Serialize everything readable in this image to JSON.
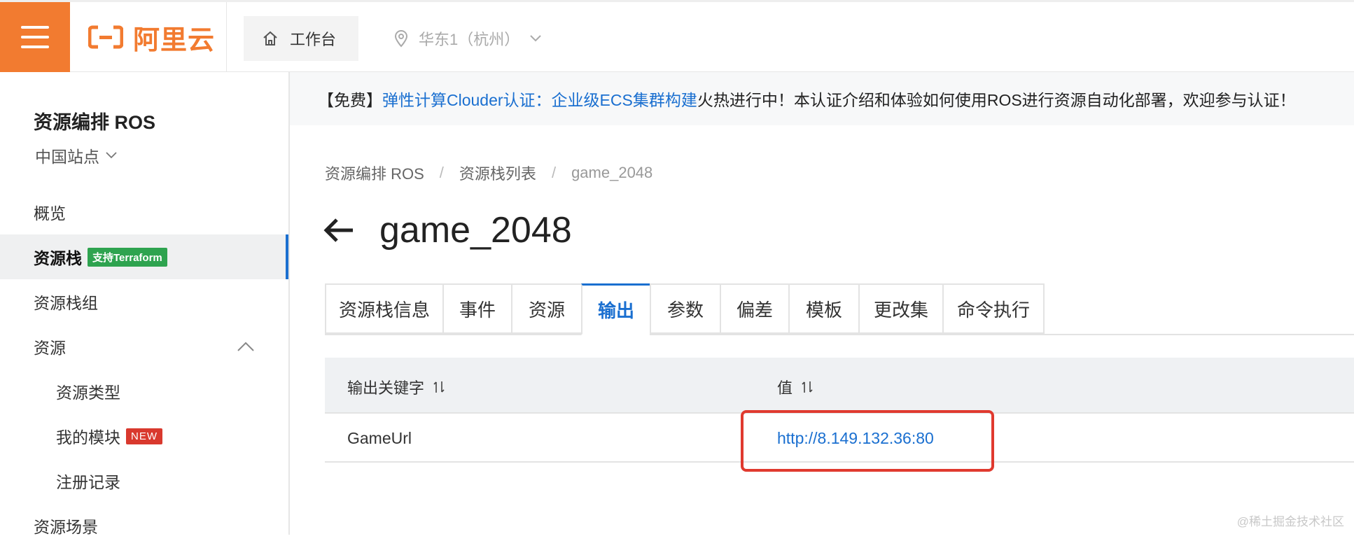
{
  "header": {
    "logo_text": "阿里云",
    "workbench_label": "工作台",
    "region_label": "华东1（杭州）"
  },
  "sidebar": {
    "title": "资源编排 ROS",
    "site": "中国站点",
    "items": [
      {
        "label": "概览"
      },
      {
        "label": "资源栈",
        "badge": "支持Terraform"
      },
      {
        "label": "资源栈组"
      },
      {
        "label": "资源"
      },
      {
        "label": "资源类型"
      },
      {
        "label": "我的模块",
        "badge": "NEW"
      },
      {
        "label": "注册记录"
      },
      {
        "label": "资源场景"
      }
    ]
  },
  "notice": {
    "prefix": "【免费】",
    "link1": "弹性计算Clouder认证：",
    "link2": "企业级ECS集群构建",
    "suffix": "火热进行中！本认证介绍和体验如何使用ROS进行资源自动化部署，欢迎参与认证！"
  },
  "breadcrumb": [
    "资源编排 ROS",
    "资源栈列表",
    "game_2048"
  ],
  "page": {
    "title": "game_2048"
  },
  "tabs": [
    "资源栈信息",
    "事件",
    "资源",
    "输出",
    "参数",
    "偏差",
    "模板",
    "更改集",
    "命令执行"
  ],
  "table": {
    "headers": [
      "输出关键字",
      "值"
    ],
    "rows": [
      {
        "key": "GameUrl",
        "value": "http://8.149.132.36:80"
      }
    ]
  },
  "watermark": "@稀土掘金技术社区",
  "colors": {
    "brand": "#f27b30",
    "link": "#1a6fd0",
    "highlight": "#e03a2f",
    "badge_tf": "#2ea34f",
    "badge_new": "#d9392e"
  }
}
